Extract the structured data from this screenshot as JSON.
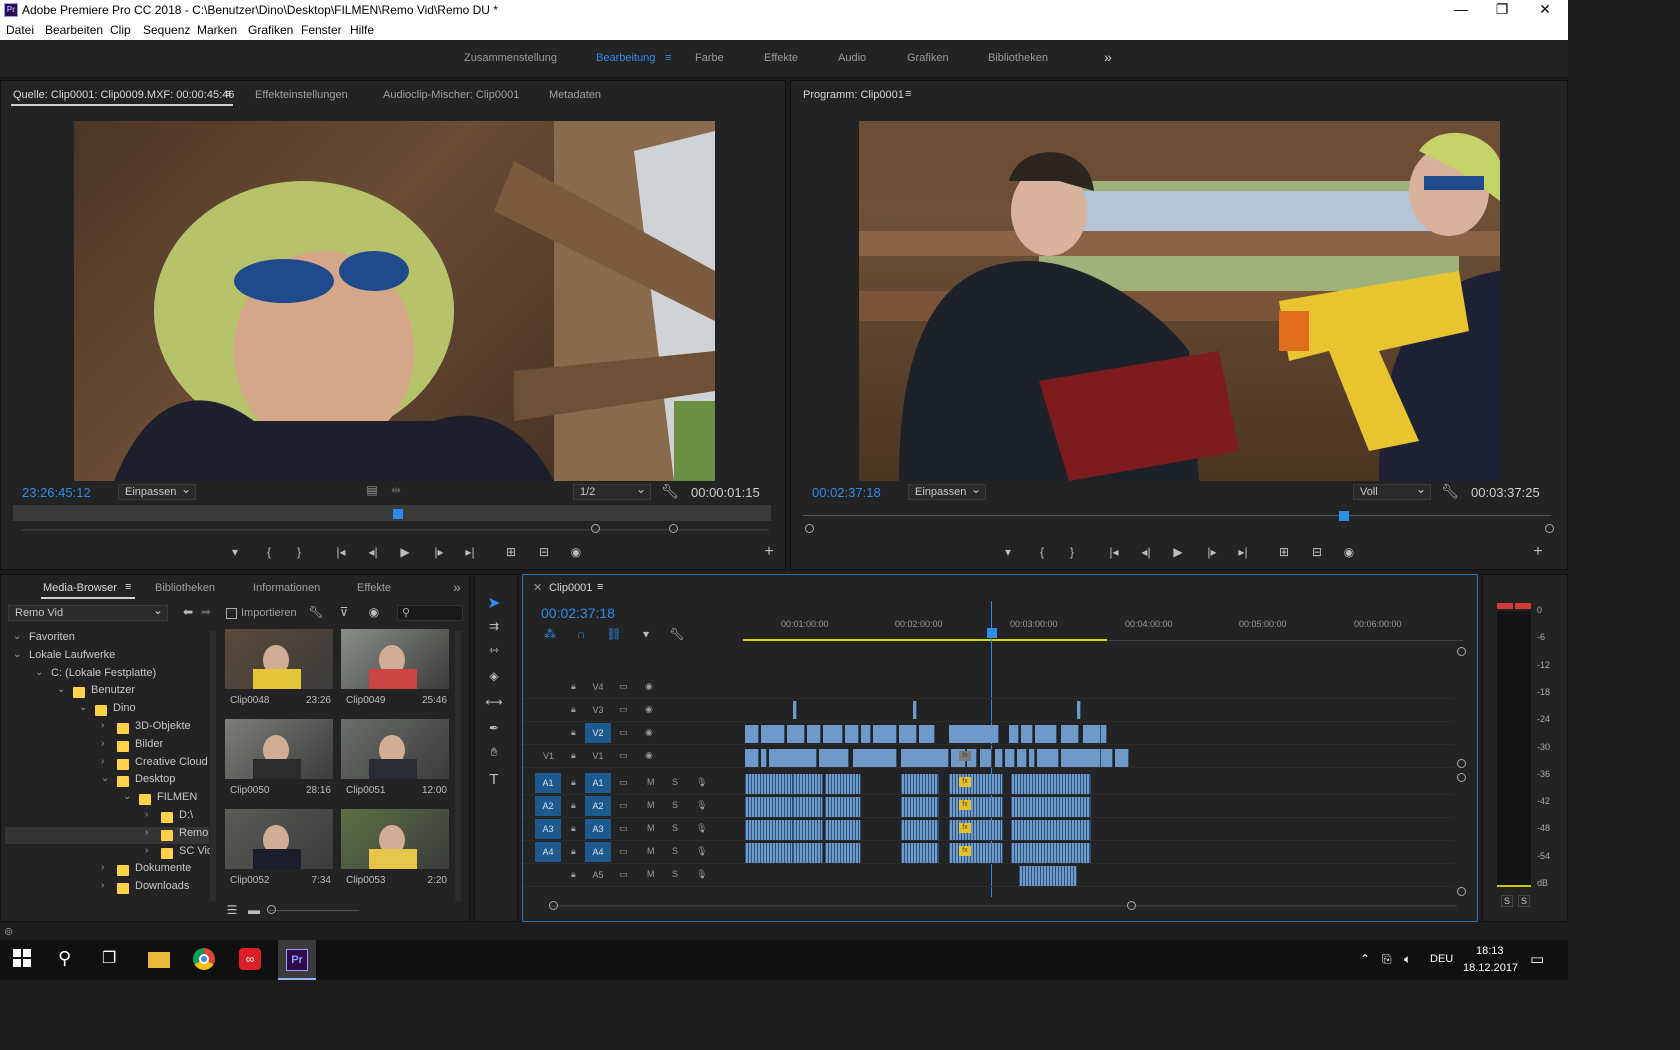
{
  "window": {
    "title": "Adobe Premiere Pro CC 2018 - C:\\Benutzer\\Dino\\Desktop\\FILMEN\\Remo Vid\\Remo DU *",
    "app_badge": "Pr",
    "minimize": "—",
    "maximize": "❐",
    "close": "✕"
  },
  "menu": [
    "Datei",
    "Bearbeiten",
    "Clip",
    "Sequenz",
    "Marken",
    "Grafiken",
    "Fenster",
    "Hilfe"
  ],
  "workspaces": {
    "items": [
      "Zusammenstellung",
      "Bearbeitung",
      "Farbe",
      "Effekte",
      "Audio",
      "Grafiken",
      "Bibliotheken"
    ],
    "active": "Bearbeitung",
    "more": "»"
  },
  "source": {
    "tabs": [
      "Quelle: Clip0001: Clip0009.MXF: 00:00:45:46",
      "Effekteinstellungen",
      "Audioclip-Mischer: Clip0001",
      "Metadaten"
    ],
    "timecode": "23:26:45:12",
    "fit": "Einpassen",
    "resolution": "1/2",
    "duration": "00:00:01:15"
  },
  "program": {
    "tab": "Programm: Clip0001",
    "timecode": "00:02:37:18",
    "fit": "Einpassen",
    "resolution": "Voll",
    "duration": "00:03:37:25"
  },
  "transport": {
    "marker": "▾",
    "in": "{",
    "out": "}",
    "go_in": "|◂",
    "step_back": "◂|",
    "play": "▶",
    "step_fwd": "|▸",
    "go_out": "▸|",
    "insert": "⊞",
    "overwrite": "⊟",
    "export": "◉",
    "add": "+"
  },
  "media_browser": {
    "tabs": [
      "Media-Browser",
      "Bibliotheken",
      "Informationen",
      "Effekte"
    ],
    "more": "»",
    "location": "Remo Vid",
    "import_label": "Importieren",
    "tree": [
      {
        "label": "Favoriten",
        "level": 0
      },
      {
        "label": "Lokale Laufwerke",
        "level": 0
      },
      {
        "label": "C: (Lokale Festplatte)",
        "level": 1
      },
      {
        "label": "Benutzer",
        "level": 2
      },
      {
        "label": "Dino",
        "level": 3
      },
      {
        "label": "3D-Objekte",
        "level": 4
      },
      {
        "label": "Bilder",
        "level": 4
      },
      {
        "label": "Creative Cloud I",
        "level": 4
      },
      {
        "label": "Desktop",
        "level": 4
      },
      {
        "label": "FILMEN",
        "level": 5
      },
      {
        "label": "D:\\",
        "level": 6
      },
      {
        "label": "Remo",
        "level": 6
      },
      {
        "label": "SC Vid",
        "level": 6
      },
      {
        "label": "Dokumente",
        "level": 4
      },
      {
        "label": "Downloads",
        "level": 4
      }
    ],
    "clips": [
      {
        "name": "Clip0048",
        "dur": "23:26"
      },
      {
        "name": "Clip0049",
        "dur": "25:46"
      },
      {
        "name": "Clip0050",
        "dur": "28:16"
      },
      {
        "name": "Clip0051",
        "dur": "12:00"
      },
      {
        "name": "Clip0052",
        "dur": "7:34"
      },
      {
        "name": "Clip0053",
        "dur": "2:20"
      }
    ]
  },
  "timeline": {
    "tab": "Clip0001",
    "timecode": "00:02:37:18",
    "ruler": [
      "00:01:00:00",
      "00:02:00:00",
      "00:03:00:00",
      "00:04:00:00",
      "00:05:00:00",
      "00:06:00:00"
    ],
    "video_tracks": [
      {
        "src": "",
        "name": "V4"
      },
      {
        "src": "",
        "name": "V3"
      },
      {
        "src": "",
        "name": "V2"
      },
      {
        "src": "V1",
        "name": "V1"
      }
    ],
    "audio_tracks": [
      {
        "src": "A1",
        "name": "A1"
      },
      {
        "src": "A2",
        "name": "A2"
      },
      {
        "src": "A3",
        "name": "A3"
      },
      {
        "src": "A4",
        "name": "A4"
      },
      {
        "src": "",
        "name": "A5"
      }
    ],
    "mute": "M",
    "solo": "S"
  },
  "meter": {
    "scale": [
      "0",
      "-6",
      "-12",
      "-18",
      "-24",
      "-30",
      "-36",
      "-42",
      "-48",
      "-54",
      "dB"
    ],
    "solo": [
      "S",
      "S"
    ]
  },
  "taskbar": {
    "lang": "DEU",
    "time": "18:13",
    "date": "18.12.2017",
    "premiere_badge": "Pr"
  }
}
